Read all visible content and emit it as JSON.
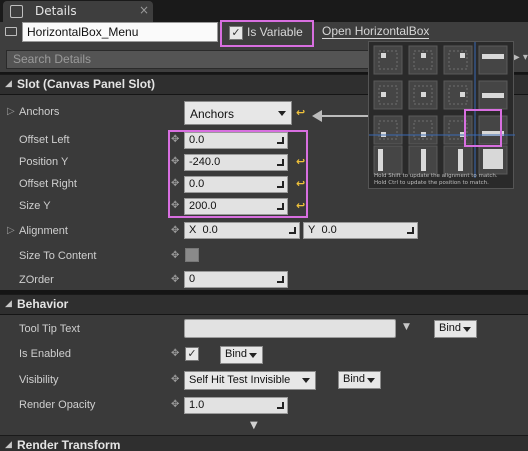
{
  "tab": {
    "title": "Details",
    "close": "×"
  },
  "header": {
    "name_value": "HorizontalBox_Menu",
    "is_variable_label": "Is Variable",
    "is_variable_checked": true,
    "open_link": "Open HorizontalBox"
  },
  "search": {
    "placeholder": "Search Details"
  },
  "sections": {
    "slot": "Slot (Canvas Panel Slot)",
    "behavior": "Behavior",
    "render_transform": "Render Transform"
  },
  "slot": {
    "anchors_label": "Anchors",
    "anchors_value": "Anchors",
    "offset_left_label": "Offset Left",
    "offset_left_value": "0.0",
    "position_y_label": "Position Y",
    "position_y_value": "-240.0",
    "offset_right_label": "Offset Right",
    "offset_right_value": "0.0",
    "size_y_label": "Size Y",
    "size_y_value": "200.0",
    "alignment_label": "Alignment",
    "alignment_x_label": "X",
    "alignment_x_value": "0.0",
    "alignment_y_label": "Y",
    "alignment_y_value": "0.0",
    "size_to_content_label": "Size To Content",
    "zorder_label": "ZOrder",
    "zorder_value": "0"
  },
  "behavior": {
    "tooltip_label": "Tool Tip Text",
    "tooltip_value": "",
    "bind_label": "Bind",
    "is_enabled_label": "Is Enabled",
    "visibility_label": "Visibility",
    "visibility_value": "Self Hit Test Invisible",
    "render_opacity_label": "Render Opacity",
    "render_opacity_value": "1.0"
  },
  "anchor_popup": {
    "note1": "Hold Shift to update the alignment to match.",
    "note2": "Hold Ctrl to update the position to match."
  },
  "colors": {
    "highlight": "#d86fe0",
    "reset_arrow": "#f0c23a"
  }
}
